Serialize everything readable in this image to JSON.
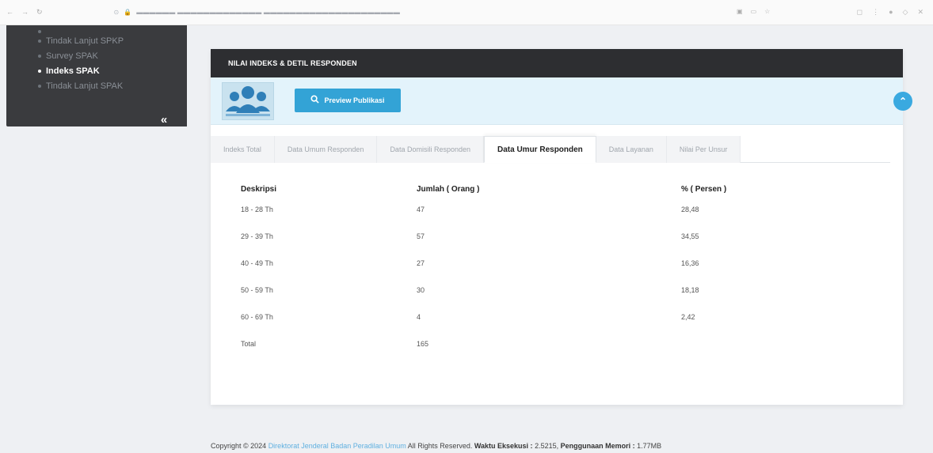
{
  "sidebar": {
    "items": [
      {
        "label": "Tindak Lanjut SPKP",
        "active": false
      },
      {
        "label": "Survey SPAK",
        "active": false
      },
      {
        "label": "Indeks SPAK",
        "active": true
      },
      {
        "label": "Tindak Lanjut SPAK",
        "active": false
      }
    ],
    "collapse_label": "«"
  },
  "panel": {
    "title": "NILAI INDEKS & DETIL RESPONDEN",
    "preview_label": "Preview Publikasi"
  },
  "tabs": [
    {
      "label": "Indeks Total",
      "active": false
    },
    {
      "label": "Data Umum Responden",
      "active": false
    },
    {
      "label": "Data Domisili Responden",
      "active": false
    },
    {
      "label": "Data Umur Responden",
      "active": true
    },
    {
      "label": "Data Layanan",
      "active": false
    },
    {
      "label": "Nilai Per Unsur",
      "active": false
    }
  ],
  "table": {
    "headers": [
      "Deskripsi",
      "Jumlah ( Orang )",
      "% ( Persen )"
    ],
    "rows": [
      [
        "18 - 28 Th",
        "47",
        "28,48"
      ],
      [
        "29 - 39 Th",
        "57",
        "34,55"
      ],
      [
        "40 - 49 Th",
        "27",
        "16,36"
      ],
      [
        "50 - 59 Th",
        "30",
        "18,18"
      ],
      [
        "60 - 69 Th",
        "4",
        "2,42"
      ],
      [
        "Total",
        "165",
        ""
      ]
    ]
  },
  "footer": {
    "copyright": "Copyright © 2024",
    "org": "Direktorat Jenderal Badan Peradilan Umum",
    "rights": "All Rights Reserved.",
    "exec_label": "Waktu Eksekusi :",
    "exec_value": "2.5215,",
    "mem_label": "Penggunaan Memori :",
    "mem_value": "1.77MB"
  },
  "colors": {
    "header_dark": "#2d2e31",
    "hero_bg": "#e3f3fb",
    "button_blue": "#33a3d6",
    "sidebar_bg": "#3a3b3e"
  }
}
